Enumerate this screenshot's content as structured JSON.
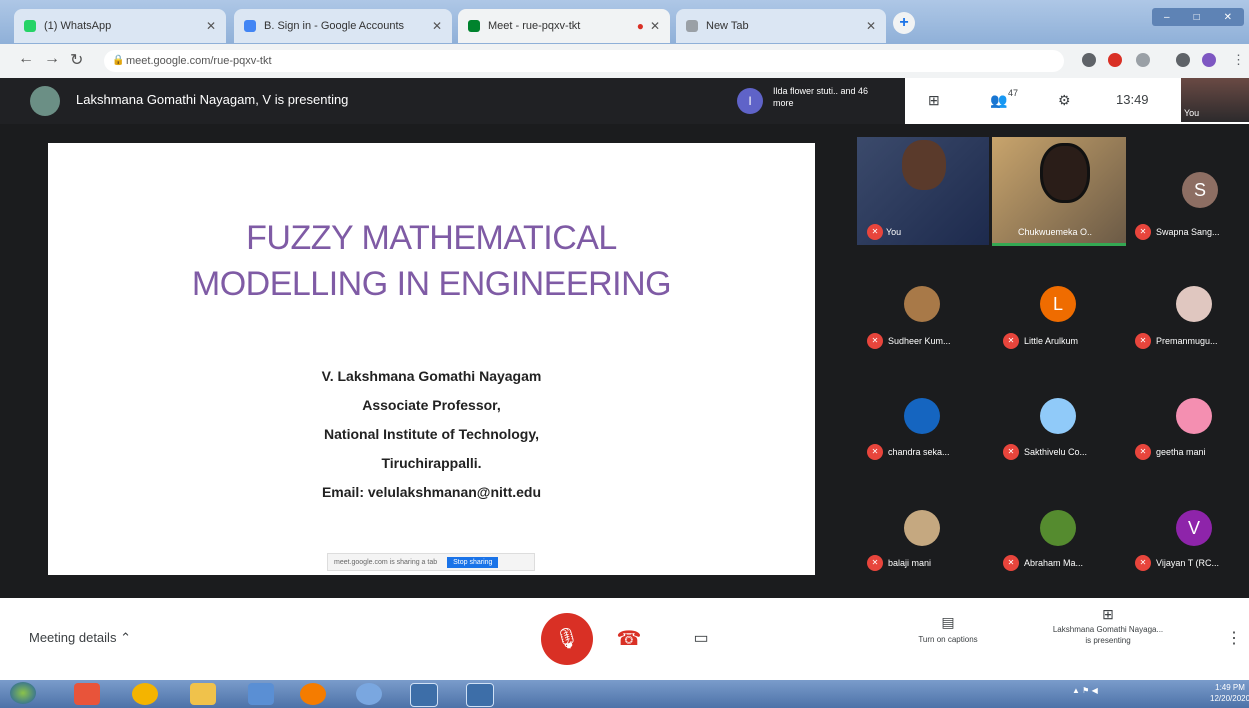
{
  "browser": {
    "tabs": [
      {
        "title": "(1) WhatsApp",
        "fav": "#25d366"
      },
      {
        "title": "B. Sign in - Google Accounts",
        "fav": "#4285f4"
      },
      {
        "title": "Meet - rue-pqxv-tkt",
        "fav": "#00832d"
      },
      {
        "title": "New Tab",
        "fav": "#9aa0a6"
      }
    ],
    "url": "meet.google.com/rue-pqxv-tkt",
    "new_tab": "+",
    "window_controls": [
      "–",
      "□",
      "✕"
    ]
  },
  "meet": {
    "presenting_text": "Lakshmana Gomathi Nayagam, V is presenting",
    "others_initial": "I",
    "others_text": "Ilda flower stuti.. and 46 more",
    "people_count": "47",
    "clock": "13:49",
    "self_name": "You"
  },
  "slide": {
    "title_line1": "FUZZY MATHEMATICAL",
    "title_line2": "MODELLING IN ENGINEERING",
    "author": "V. Lakshmana Gomathi Nayagam",
    "position": "Associate Professor,",
    "institute": "National Institute of Technology,",
    "city": "Tiruchirappalli.",
    "email": "Email: velulakshmanan@nitt.edu",
    "share_bar_text": "meet.google.com is sharing a tab",
    "share_bar_button": "Stop sharing"
  },
  "participants": [
    {
      "name": "You"
    },
    {
      "name": "Chukwuemeka O.."
    },
    {
      "name": "Swapna Sang...",
      "initial": "S",
      "color": "#8d6e63"
    },
    {
      "name": "Sudheer Kum..."
    },
    {
      "name": "Little Arulkum",
      "initial": "L",
      "color": "#ef6c00"
    },
    {
      "name": "Premanmugu..."
    },
    {
      "name": "chandra seka..."
    },
    {
      "name": "Sakthivelu Co..."
    },
    {
      "name": "geetha mani"
    },
    {
      "name": "balaji mani"
    },
    {
      "name": "Abraham Ma..."
    },
    {
      "name": "Vijayan T (RC...",
      "initial": "V",
      "color": "#8e24aa"
    }
  ],
  "bottom": {
    "meeting_details": "Meeting details",
    "captions_label": "Turn on captions",
    "present_label_1": "Lakshmana Gomathi Nayaga...",
    "present_label_2": "is presenting",
    "more": "⋮"
  },
  "taskbar": {
    "time": "1:49 PM",
    "date": "12/20/2020"
  }
}
